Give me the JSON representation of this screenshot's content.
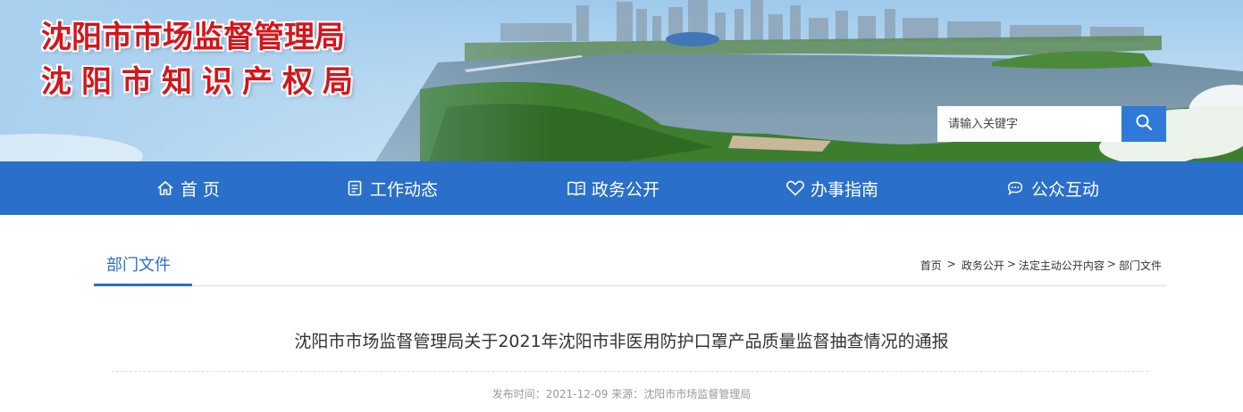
{
  "header": {
    "title_line1": "沈阳市市场监督管理局",
    "title_line2": "沈阳市知识产权局",
    "title_color": "#d2161c"
  },
  "search": {
    "placeholder": "请输入关键字",
    "button_icon": "search-icon",
    "button_color": "#2f7ad8"
  },
  "nav": {
    "bg_color": "#2a6fc9",
    "items": [
      {
        "label": "首 页",
        "icon": "home-icon"
      },
      {
        "label": "工作动态",
        "icon": "document-icon"
      },
      {
        "label": "政务公开",
        "icon": "book-icon"
      },
      {
        "label": "办事指南",
        "icon": "heart-icon"
      },
      {
        "label": "公众互动",
        "icon": "chat-icon"
      }
    ]
  },
  "section": {
    "tab_label": "部门文件"
  },
  "breadcrumb": {
    "items": [
      "首页",
      "政务公开",
      "法定主动公开内容",
      "部门文件"
    ],
    "sep_first": ">",
    "sep": ">"
  },
  "article": {
    "title": "沈阳市市场监督管理局关于2021年沈阳市非医用防护口罩产品质量监督抽查情况的通报",
    "date_label": "发布时间：",
    "date": "2021-12-09",
    "source_label": "来源：",
    "source": "沈阳市市场监督管理局"
  }
}
